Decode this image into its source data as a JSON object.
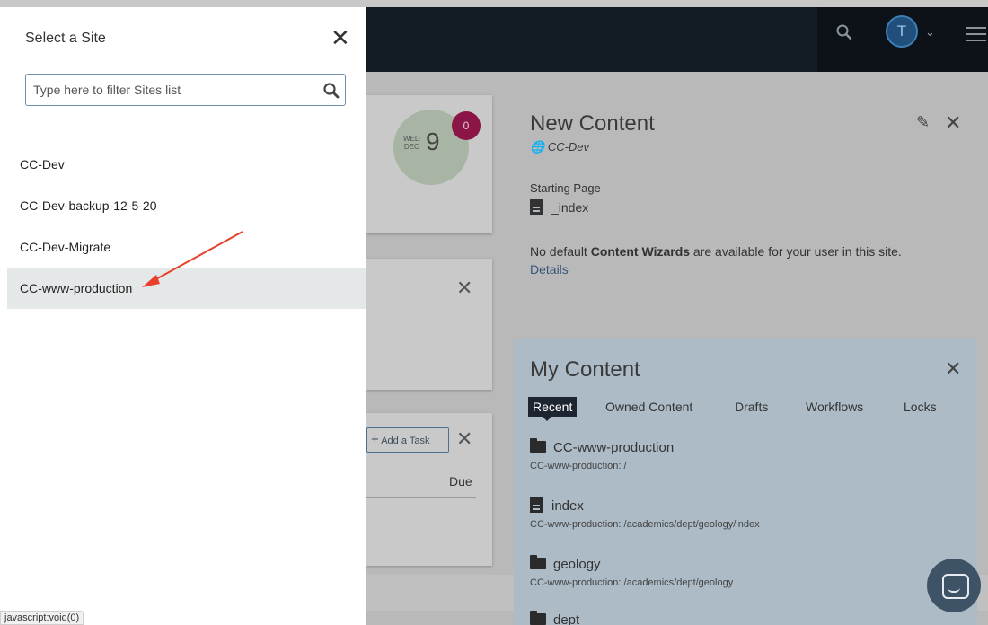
{
  "site_picker": {
    "title": "Select a Site",
    "filter_placeholder": "Type here to filter Sites list",
    "sites": [
      {
        "label": "CC-Dev"
      },
      {
        "label": "CC-Dev-backup-12-5-20"
      },
      {
        "label": "CC-Dev-Migrate"
      },
      {
        "label": "CC-www-production",
        "highlighted": true
      }
    ]
  },
  "topbar": {
    "avatar_initial": "T",
    "icons": [
      "search-icon",
      "chevron-down-icon",
      "hamburger-menu-icon"
    ]
  },
  "calendar": {
    "weekday": "WED",
    "month": "DEC",
    "day": "9",
    "badge_count": "0"
  },
  "tasks": {
    "add_task_label": "Add a Task",
    "due_header": "Due"
  },
  "new_content": {
    "title": "New Content",
    "site": "CC-Dev",
    "starting_page_label": "Starting Page",
    "starting_page": "_index",
    "message_pre": "No default ",
    "message_bold": "Content Wizards",
    "message_post": " are available for your user in this site.",
    "details_link": "Details"
  },
  "my_content": {
    "title": "My Content",
    "tabs": [
      {
        "label": "Recent",
        "active": true
      },
      {
        "label": "Owned Content"
      },
      {
        "label": "Drafts"
      },
      {
        "label": "Workflows"
      },
      {
        "label": "Locks"
      }
    ],
    "items": [
      {
        "name": "CC-www-production",
        "path": "CC-www-production: /",
        "icon": "folder-icon"
      },
      {
        "name": "index",
        "path": "CC-www-production: /academics/dept/geology/index",
        "icon": "document-icon"
      },
      {
        "name": "geology",
        "path": "CC-www-production: /academics/dept/geology",
        "icon": "folder-icon"
      },
      {
        "name": "dept",
        "path": "",
        "icon": "folder-icon"
      }
    ]
  },
  "status_bar": {
    "text": "javascript:void(0)"
  },
  "colors": {
    "topbar": "#121a22",
    "panel_bg": "#ffffff",
    "highlight_row": "#e4e8e8",
    "annotation_arrow": "#e8402a",
    "badge": "#8c1547"
  }
}
